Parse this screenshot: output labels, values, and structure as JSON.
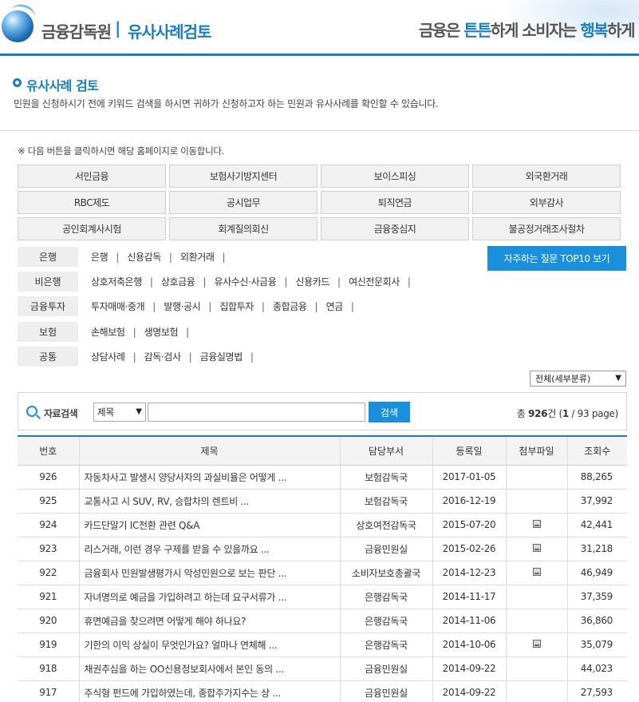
{
  "header": {
    "org_name": "금융감독원",
    "separator": "|",
    "site_name": "유사사례검토",
    "slogan_parts": [
      "금융은 ",
      "튼튼",
      "하게 소비자는 ",
      "행복",
      "하게"
    ]
  },
  "page": {
    "title": "유사사례 검토",
    "description": "민원을 신청하시기 전에 키워드 검색을 하시면 귀하가 신청하고자 하는 민원과 유사사례를 확인할 수 있습니다.",
    "notice": "※ 다음 버튼을 클릭하시면 해당 홈페이지로 이동합니다."
  },
  "site_buttons": [
    "서민금융",
    "보험사기방지센터",
    "보이스피싱",
    "외국환거래",
    "RBC제도",
    "공시업무",
    "퇴직연금",
    "외부감사",
    "공인회계사시험",
    "회계질의회신",
    "금융중심지",
    "불공정거래조사절차"
  ],
  "categories": [
    {
      "label": "은행",
      "links": [
        "은행",
        "신용감독",
        "외환거래"
      ]
    },
    {
      "label": "비은행",
      "links": [
        "상호저축은행",
        "상호금융",
        "유사수신·사금융",
        "신용카드",
        "여신전문회사"
      ]
    },
    {
      "label": "금융투자",
      "links": [
        "투자매매·중개",
        "발행·공시",
        "집합투자",
        "종합금융",
        "연금"
      ]
    },
    {
      "label": "보험",
      "links": [
        "손해보험",
        "생명보험"
      ]
    },
    {
      "label": "공통",
      "links": [
        "상담사례",
        "감독·검사",
        "금융실명법"
      ]
    }
  ],
  "link_separator": "|",
  "faq_button": "자주하는 질문 TOP10 보기",
  "sub_category_select": "전체(세부분류)",
  "search": {
    "label": "자료검색",
    "field_select": "제목",
    "input_value": "",
    "button": "검색",
    "total_prefix": "총 ",
    "total_count": "926",
    "total_unit": "건 (",
    "current_page": "1",
    "total_pages_text": " / 93 page)"
  },
  "table": {
    "columns": [
      "번호",
      "제목",
      "담당부서",
      "등록일",
      "첨부파일",
      "조회수"
    ],
    "rows": [
      {
        "no": "926",
        "title": "자동차사고 발생시 양당사자의 과실비율은 어떻게 ...",
        "dept": "보험감독국",
        "date": "2017-01-05",
        "attach": false,
        "views": "88,265"
      },
      {
        "no": "925",
        "title": "교통사고 시 SUV, RV, 승합차의 렌트비 ...",
        "dept": "보험감독국",
        "date": "2016-12-19",
        "attach": false,
        "views": "37,992"
      },
      {
        "no": "924",
        "title": "카드단말기 IC전환 관련 Q&A",
        "dept": "상호여전감독국",
        "date": "2015-07-20",
        "attach": true,
        "views": "42,441"
      },
      {
        "no": "923",
        "title": "리스거래, 이런 경우 구제를 받을 수 있을까요 ...",
        "dept": "금융민원실",
        "date": "2015-02-26",
        "attach": true,
        "views": "31,218"
      },
      {
        "no": "922",
        "title": "금융회사 민원발생평가시 악성민원으로 보는 판단 ...",
        "dept": "소비자보호총괄국",
        "date": "2014-12-23",
        "attach": true,
        "views": "46,949"
      },
      {
        "no": "921",
        "title": "자녀명의로 예금을 가입하려고 하는데 요구서류가 ...",
        "dept": "은행감독국",
        "date": "2014-11-17",
        "attach": false,
        "views": "37,359"
      },
      {
        "no": "920",
        "title": "휴면예금을 찾으려면 어떻게 해야 하나요?",
        "dept": "은행감독국",
        "date": "2014-11-06",
        "attach": false,
        "views": "36,860"
      },
      {
        "no": "919",
        "title": "기한의 이익 상실이 무엇인가요? 얼마나 연체해 ...",
        "dept": "은행감독국",
        "date": "2014-10-06",
        "attach": true,
        "views": "35,079"
      },
      {
        "no": "918",
        "title": "채권추심을 하는 OO신용정보회사에서 본인 동의 ...",
        "dept": "금융민원실",
        "date": "2014-09-22",
        "attach": false,
        "views": "44,023"
      },
      {
        "no": "917",
        "title": "주식형 펀드에 가입하였는데, 종합주가지수는 상 ...",
        "dept": "금융민원실",
        "date": "2014-09-22",
        "attach": false,
        "views": "27,593"
      }
    ]
  },
  "icons": {
    "logo": "globe-logo-icon",
    "search": "search-icon",
    "attachment": "file-icon"
  }
}
